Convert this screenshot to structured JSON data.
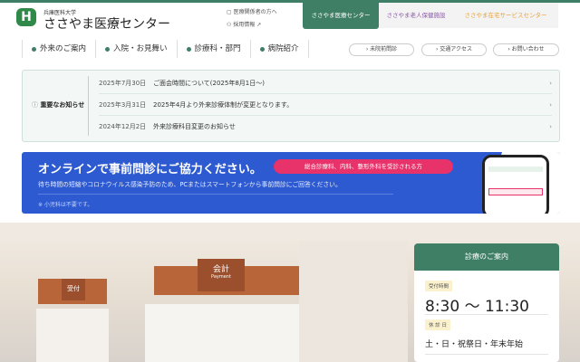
{
  "header": {
    "logo_mark": "H",
    "university": "兵庫医科大学",
    "site_name": "ささやま医療センター",
    "links": [
      "医療関係者の方へ",
      "採用情報"
    ],
    "site_tabs": [
      {
        "label": "ささやま医療センター",
        "color": "#ffffff"
      },
      {
        "label": "ささやま老人保健施設",
        "color": "#8a5aa8"
      },
      {
        "label": "ささやま在宅サービスセンター",
        "color": "#e8a23a"
      }
    ]
  },
  "nav": {
    "items": [
      "外来のご案内",
      "入院・お見舞い",
      "診療科・部門",
      "病院紹介"
    ],
    "pills": [
      "未院前問診",
      "交通アクセス",
      "お問い合わせ"
    ]
  },
  "notice": {
    "label": "重要なお知らせ",
    "items": [
      {
        "date": "2025年7月30日",
        "text": "ご面会時間について(2025年8月1日〜)"
      },
      {
        "date": "2025年3月31日",
        "text": "2025年4月より外来診療体制が変更となります。"
      },
      {
        "date": "2024年12月2日",
        "text": "外来診療科目変更のお知らせ"
      }
    ]
  },
  "banner": {
    "title": "オンラインで事前問診にご協力ください。",
    "tag": "総合診療科、内科、整形外科を受診される方",
    "subtitle": "待ち時間の短縮やコロナウイルス感染予防のため、PCまたはスマートフォンから事前問診にご回答ください。",
    "note": "※ 小児科は不要です。"
  },
  "hero": {
    "sign1": "受付",
    "sign2": "会計",
    "sign2_en": "Payment"
  },
  "card": {
    "title": "診療のご案内",
    "hours_label": "受付時間",
    "hours": "8:30 〜 11:30",
    "closed_label": "休 診 日",
    "closed": "土・日・祝祭日・年末年始"
  }
}
